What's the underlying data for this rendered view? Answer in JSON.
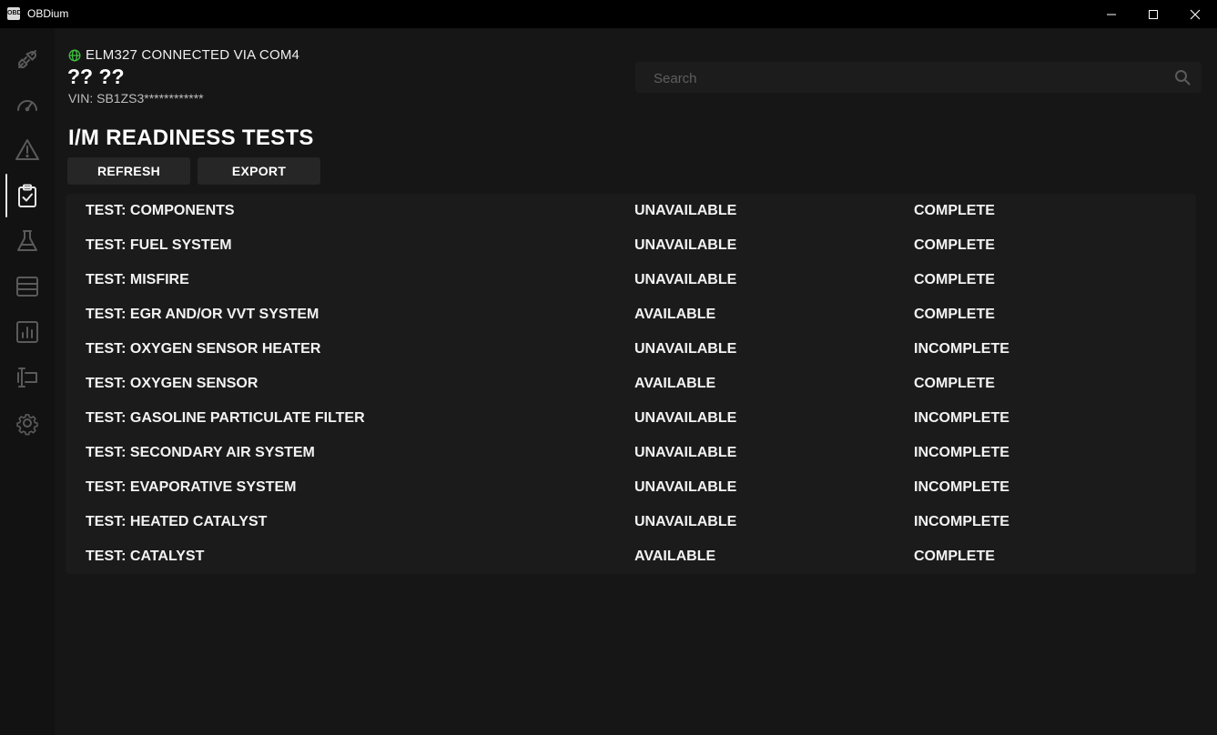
{
  "window": {
    "title": "OBDium",
    "app_icon_text": "OBD"
  },
  "sidebar": {
    "items": [
      {
        "name": "connection",
        "icon": "plug-icon"
      },
      {
        "name": "dashboard",
        "icon": "gauge-icon"
      },
      {
        "name": "trouble-codes",
        "icon": "warning-icon"
      },
      {
        "name": "readiness",
        "icon": "clipboard-check-icon",
        "active": true
      },
      {
        "name": "tests",
        "icon": "flask-icon"
      },
      {
        "name": "data",
        "icon": "database-icon"
      },
      {
        "name": "graphs",
        "icon": "chart-icon"
      },
      {
        "name": "terminal",
        "icon": "terminal-icon"
      },
      {
        "name": "settings",
        "icon": "gear-icon"
      }
    ]
  },
  "header": {
    "connection_status": "ELM327 CONNECTED VIA COM4",
    "connection_color": "#3fbf3f",
    "vehicle_name": "?? ??",
    "vin": "VIN: SB1ZS3************"
  },
  "search": {
    "placeholder": "Search",
    "value": ""
  },
  "page": {
    "title": "I/M READINESS TESTS",
    "refresh_label": "REFRESH",
    "export_label": "EXPORT"
  },
  "tests": [
    {
      "name": "TEST: COMPONENTS",
      "availability": "UNAVAILABLE",
      "status": "COMPLETE"
    },
    {
      "name": "TEST: FUEL SYSTEM",
      "availability": "UNAVAILABLE",
      "status": "COMPLETE"
    },
    {
      "name": "TEST: MISFIRE",
      "availability": "UNAVAILABLE",
      "status": "COMPLETE"
    },
    {
      "name": "TEST: EGR AND/OR VVT SYSTEM",
      "availability": "AVAILABLE",
      "status": "COMPLETE"
    },
    {
      "name": "TEST: OXYGEN SENSOR HEATER",
      "availability": "UNAVAILABLE",
      "status": "INCOMPLETE"
    },
    {
      "name": "TEST: OXYGEN SENSOR",
      "availability": "AVAILABLE",
      "status": "COMPLETE"
    },
    {
      "name": "TEST: GASOLINE PARTICULATE FILTER",
      "availability": "UNAVAILABLE",
      "status": "INCOMPLETE"
    },
    {
      "name": "TEST: SECONDARY AIR SYSTEM",
      "availability": "UNAVAILABLE",
      "status": "INCOMPLETE"
    },
    {
      "name": "TEST: EVAPORATIVE SYSTEM",
      "availability": "UNAVAILABLE",
      "status": "INCOMPLETE"
    },
    {
      "name": "TEST: HEATED CATALYST",
      "availability": "UNAVAILABLE",
      "status": "INCOMPLETE"
    },
    {
      "name": "TEST: CATALYST",
      "availability": "AVAILABLE",
      "status": "COMPLETE"
    }
  ]
}
